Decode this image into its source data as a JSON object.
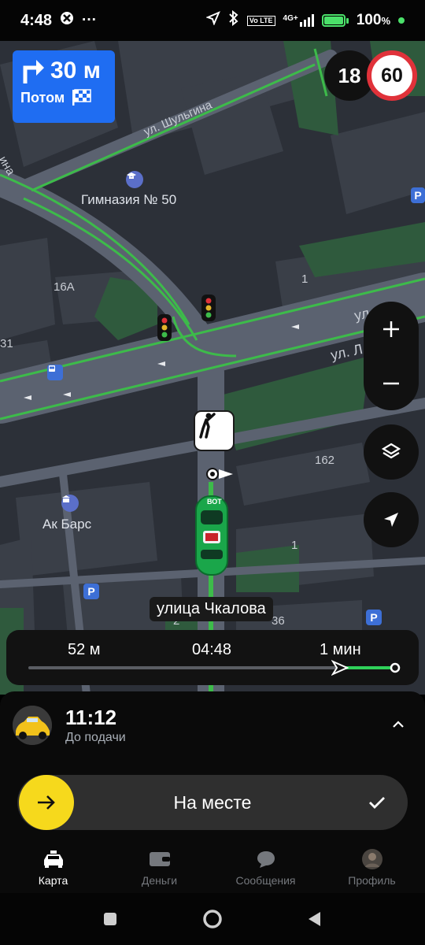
{
  "status_bar": {
    "time": "4:48",
    "more": "···",
    "battery": "100",
    "battery_unit": "%",
    "network": "4G+",
    "volte": "Vo LTE"
  },
  "maneuver": {
    "distance": "30 м",
    "next_label": "Потом"
  },
  "speed": {
    "current": "18",
    "limit": "60"
  },
  "map": {
    "labels": {
      "gymnasium": "Гимназия № 50",
      "bank": "Ак Барс",
      "house_16a": "16А",
      "house_1_top": "1",
      "house_162": "162",
      "house_1_mid": "1",
      "house_36": "36",
      "house_31": "31",
      "house_2": "2"
    },
    "streets": {
      "shulgina": "ул. Шульгина",
      "ul_right1": "ул. по",
      "ul_right2": "ул. Л",
      "left_edge": "ина"
    },
    "current_street": "улица Чкалова",
    "car_badge": "ВОТ"
  },
  "route": {
    "distance": "52 м",
    "arrival": "04:48",
    "remaining": "1 мин",
    "progress": 0.85
  },
  "order": {
    "time": "11:12",
    "subtitle": "До подачи"
  },
  "action": {
    "label": "На месте"
  },
  "tabs": [
    {
      "label": "Карта"
    },
    {
      "label": "Деньги"
    },
    {
      "label": "Сообщения"
    },
    {
      "label": "Профиль"
    }
  ],
  "colors": {
    "accent_blue": "#1f6df2",
    "route_green": "#2fd15a",
    "limit_red": "#e0323a",
    "action_yellow": "#f6d91c"
  }
}
